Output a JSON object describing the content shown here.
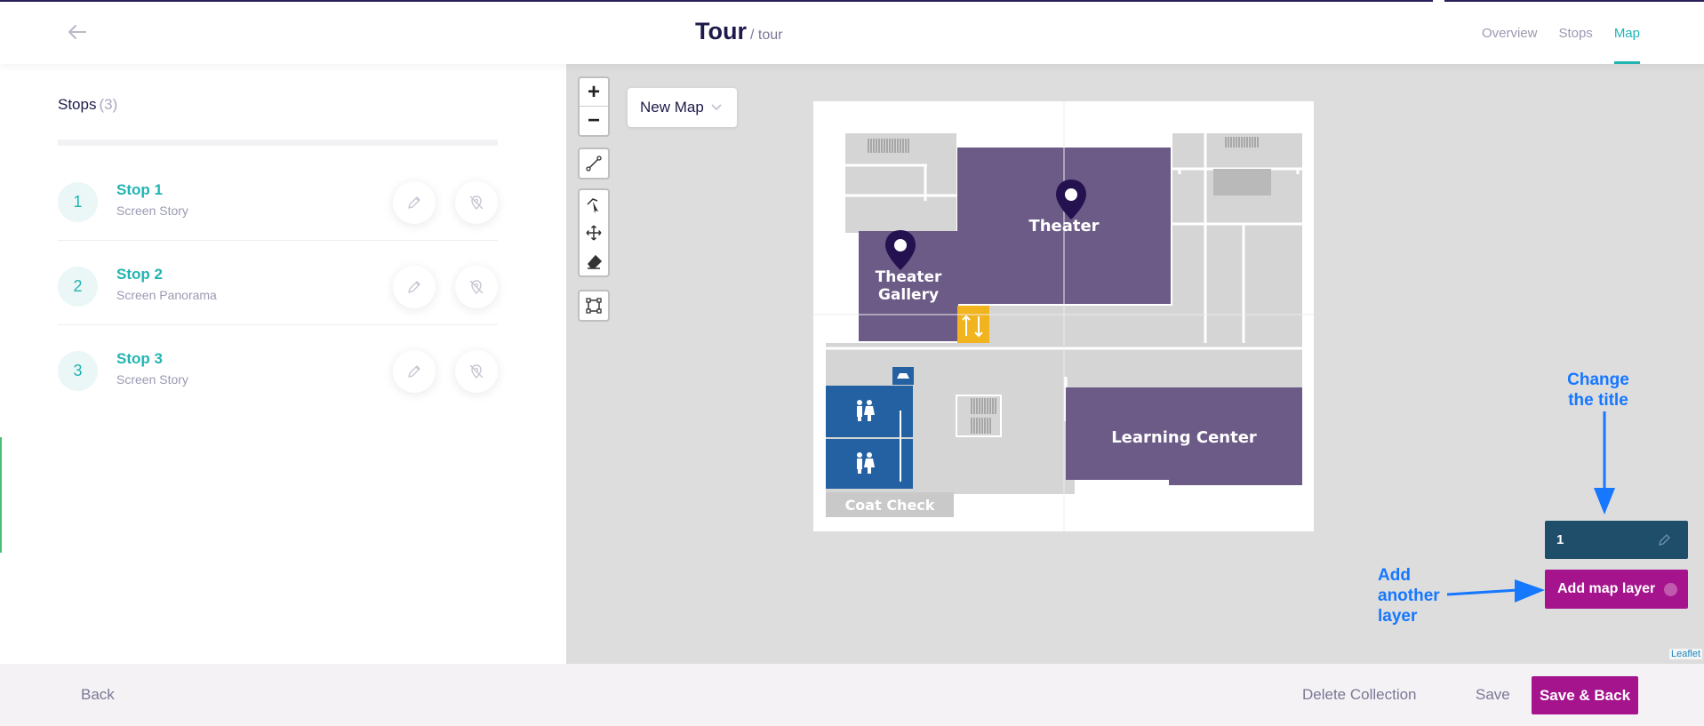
{
  "header": {
    "title": "Tour",
    "subtitle": "/ tour",
    "tabs": [
      {
        "label": "Overview",
        "active": false
      },
      {
        "label": "Stops",
        "active": false
      },
      {
        "label": "Map",
        "active": true
      }
    ]
  },
  "sidebar": {
    "title": "Stops",
    "count": "(3)",
    "stops": [
      {
        "number": "1",
        "name": "Stop 1",
        "type": "Screen Story"
      },
      {
        "number": "2",
        "name": "Stop 2",
        "type": "Screen Panorama"
      },
      {
        "number": "3",
        "name": "Stop 3",
        "type": "Screen Story"
      }
    ]
  },
  "map": {
    "zoom_in": "+",
    "zoom_out": "−",
    "map_select": "New Map",
    "rooms": {
      "theater": "Theater",
      "gallery_line1": "Theater",
      "gallery_line2": "Gallery",
      "learning": "Learning Center",
      "coat": "Coat Check"
    },
    "attribution": "Leaflet"
  },
  "layers": {
    "current_layer": "1",
    "add_label": "Add map layer"
  },
  "annotations": {
    "change_title": [
      "Change",
      "the title"
    ],
    "add_layer": [
      "Add",
      "another",
      "layer"
    ]
  },
  "footer": {
    "back": "Back",
    "delete": "Delete Collection",
    "save": "Save",
    "save_back": "Save & Back"
  },
  "colors": {
    "accent_teal": "#22b3b3",
    "primary_magenta": "#a5148d",
    "navy": "#1e1b4b",
    "room_purple": "#6b5b86",
    "restroom_blue": "#2461a3",
    "elevator_yellow": "#f2b41e",
    "annotation_blue": "#1677ff"
  }
}
